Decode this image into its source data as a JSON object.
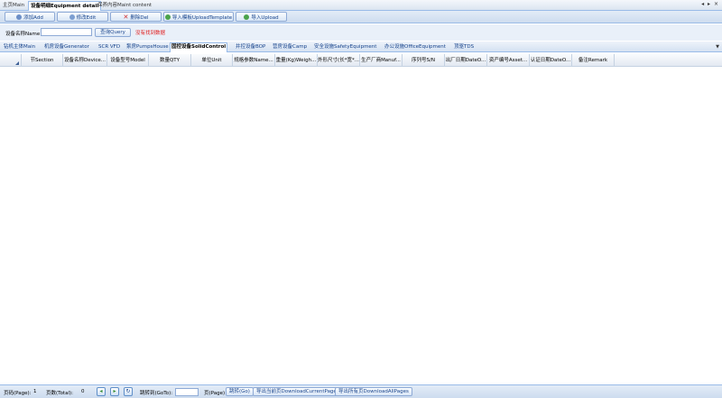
{
  "window_tabs": [
    "主页Main",
    "设备明细Equipment detail",
    "保养内容Maint content"
  ],
  "window_controls": "◂ ▸ ×",
  "toolbar": {
    "add": "添加Add",
    "edit": "修改Edit",
    "del": "删除Del",
    "template": "导入模板UploadTemplate",
    "upload": "导入Upload"
  },
  "search": {
    "label": "设备名称Name",
    "value": "",
    "query": "查询Query",
    "no_data": "没有找到数据"
  },
  "categories": [
    "钻机主体Main",
    "机房设备Generator",
    "SCR VFD",
    "泵房PumpsHouse",
    "固控设备SolidControl",
    "井控设备BOP",
    "营房设备Camp",
    "安全设施SafetyEquipment",
    "办公设施OfficeEquipment",
    "顶驱TDS"
  ],
  "active_category": 4,
  "columns": [
    "节Section",
    "设备名称Device...",
    "设备型号Model",
    "数量QTY",
    "单位Unit",
    "规格参数Name...",
    "重量(Kg)Weigh...",
    "外形尺寸(长*宽*...",
    "生产厂商Manuf...",
    "序列号S/N",
    "出厂日期DateO...",
    "资产编号Asset...",
    "认证日期DateO...",
    "备注Remark"
  ],
  "pager": {
    "pages_label": "页码(Page):",
    "pages_value": "1",
    "total_label": "页数(Total):",
    "total_value": "0",
    "goto_label": "跳转到(GoTo):",
    "page_unit": "页(Page)",
    "go": "跳转(Go)",
    "download_current": "导出当前页DownloadCurrentPage",
    "download_all": "导出所有页DownloadAllPages"
  },
  "colors": {
    "accent": "#15428b",
    "border": "#99bbe8",
    "warning": "#e01818"
  }
}
